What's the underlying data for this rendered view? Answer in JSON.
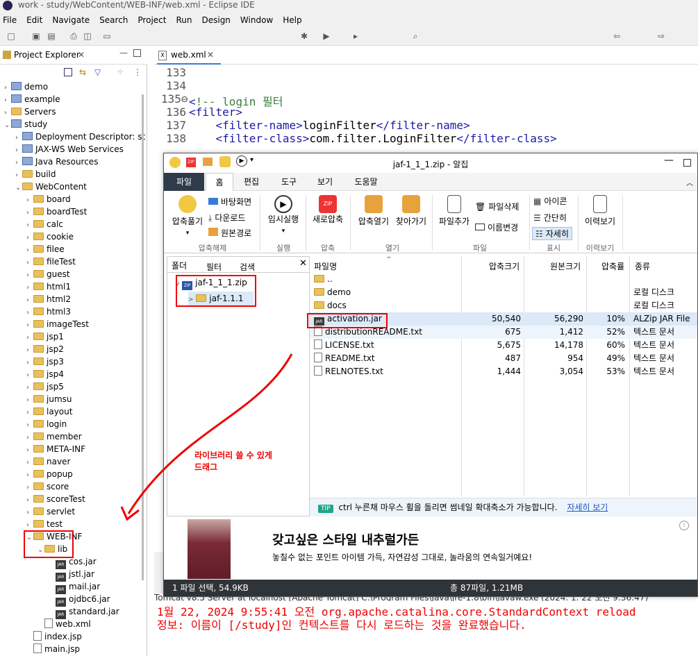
{
  "window_title": "work - study/WebContent/WEB-INF/web.xml - Eclipse IDE",
  "menu": [
    "File",
    "Edit",
    "Navigate",
    "Search",
    "Project",
    "Run",
    "Design",
    "Window",
    "Help"
  ],
  "project_explorer": {
    "title": "Project Explorer",
    "items": [
      {
        "label": "demo",
        "type": "proj",
        "depth": 0,
        "chev": ">"
      },
      {
        "label": "example",
        "type": "proj",
        "depth": 0,
        "chev": ">"
      },
      {
        "label": "Servers",
        "type": "folder",
        "depth": 0,
        "chev": ">"
      },
      {
        "label": "study",
        "type": "proj",
        "depth": 0,
        "chev": "v"
      },
      {
        "label": "Deployment Descriptor: st",
        "type": "proj",
        "depth": 1,
        "chev": ">"
      },
      {
        "label": "JAX-WS Web Services",
        "type": "proj",
        "depth": 1,
        "chev": ">"
      },
      {
        "label": "Java Resources",
        "type": "proj",
        "depth": 1,
        "chev": ">"
      },
      {
        "label": "build",
        "type": "folder",
        "depth": 1,
        "chev": ">"
      },
      {
        "label": "WebContent",
        "type": "folder",
        "depth": 1,
        "chev": "v"
      },
      {
        "label": "board",
        "type": "folder",
        "depth": 2,
        "chev": ">"
      },
      {
        "label": "boardTest",
        "type": "folder",
        "depth": 2,
        "chev": ">"
      },
      {
        "label": "calc",
        "type": "folder",
        "depth": 2,
        "chev": ">"
      },
      {
        "label": "cookie",
        "type": "folder",
        "depth": 2,
        "chev": ">"
      },
      {
        "label": "filee",
        "type": "folder",
        "depth": 2,
        "chev": ">"
      },
      {
        "label": "fileTest",
        "type": "folder",
        "depth": 2,
        "chev": ">"
      },
      {
        "label": "guest",
        "type": "folder",
        "depth": 2,
        "chev": ">"
      },
      {
        "label": "html1",
        "type": "folder",
        "depth": 2,
        "chev": ">"
      },
      {
        "label": "html2",
        "type": "folder",
        "depth": 2,
        "chev": ">"
      },
      {
        "label": "html3",
        "type": "folder",
        "depth": 2,
        "chev": ">"
      },
      {
        "label": "imageTest",
        "type": "folder",
        "depth": 2,
        "chev": ">"
      },
      {
        "label": "jsp1",
        "type": "folder",
        "depth": 2,
        "chev": ">"
      },
      {
        "label": "jsp2",
        "type": "folder",
        "depth": 2,
        "chev": ">"
      },
      {
        "label": "jsp3",
        "type": "folder",
        "depth": 2,
        "chev": ">"
      },
      {
        "label": "jsp4",
        "type": "folder",
        "depth": 2,
        "chev": ">"
      },
      {
        "label": "jsp5",
        "type": "folder",
        "depth": 2,
        "chev": ">"
      },
      {
        "label": "jumsu",
        "type": "folder",
        "depth": 2,
        "chev": ">"
      },
      {
        "label": "layout",
        "type": "folder",
        "depth": 2,
        "chev": ">"
      },
      {
        "label": "login",
        "type": "folder",
        "depth": 2,
        "chev": ">"
      },
      {
        "label": "member",
        "type": "folder",
        "depth": 2,
        "chev": ">"
      },
      {
        "label": "META-INF",
        "type": "folder",
        "depth": 2,
        "chev": ">"
      },
      {
        "label": "naver",
        "type": "folder",
        "depth": 2,
        "chev": ">"
      },
      {
        "label": "popup",
        "type": "folder",
        "depth": 2,
        "chev": ">"
      },
      {
        "label": "score",
        "type": "folder",
        "depth": 2,
        "chev": ">"
      },
      {
        "label": "scoreTest",
        "type": "folder",
        "depth": 2,
        "chev": ">"
      },
      {
        "label": "servlet",
        "type": "folder",
        "depth": 2,
        "chev": ">"
      },
      {
        "label": "test",
        "type": "folder",
        "depth": 2,
        "chev": ">"
      },
      {
        "label": "WEB-INF",
        "type": "folder",
        "depth": 2,
        "chev": "v"
      },
      {
        "label": "lib",
        "type": "folder",
        "depth": 3,
        "chev": "v"
      },
      {
        "label": "cos.jar",
        "type": "jar",
        "depth": 4,
        "chev": ""
      },
      {
        "label": "jstl.jar",
        "type": "jar",
        "depth": 4,
        "chev": ""
      },
      {
        "label": "mail.jar",
        "type": "jar",
        "depth": 4,
        "chev": ""
      },
      {
        "label": "ojdbc6.jar",
        "type": "jar",
        "depth": 4,
        "chev": ""
      },
      {
        "label": "standard.jar",
        "type": "jar",
        "depth": 4,
        "chev": ""
      },
      {
        "label": "web.xml",
        "type": "file",
        "depth": 3,
        "chev": ""
      },
      {
        "label": "index.jsp",
        "type": "file",
        "depth": 2,
        "chev": ""
      },
      {
        "label": "main.jsp",
        "type": "file",
        "depth": 2,
        "chev": ""
      }
    ]
  },
  "editor": {
    "tab": "web.xml",
    "lines": [
      {
        "n": "133",
        "parts": []
      },
      {
        "n": "134",
        "parts": []
      },
      {
        "n": "135⊖",
        "parts": [
          {
            "c": "tag",
            "t": "<"
          },
          {
            "c": "cmt",
            "t": "!-- login 필터"
          }
        ]
      },
      {
        "n": "136",
        "parts": [
          {
            "c": "tag",
            "t": "<filter>"
          }
        ]
      },
      {
        "n": "137",
        "parts": [
          {
            "c": "",
            "t": "    "
          },
          {
            "c": "tag",
            "t": "<filter-name>"
          },
          {
            "c": "",
            "t": "loginFilter"
          },
          {
            "c": "tag",
            "t": "</filter-name>"
          }
        ]
      },
      {
        "n": "138",
        "parts": [
          {
            "c": "",
            "t": "    "
          },
          {
            "c": "tag",
            "t": "<filter-class>"
          },
          {
            "c": "",
            "t": "com.filter.LoginFilter"
          },
          {
            "c": "tag",
            "t": "</filter-class>"
          }
        ]
      }
    ]
  },
  "console": {
    "header": "Tomcat v8.5 Server at localhost [Apache Tomcat] C:\\Program Files\\Java\\jre-1.8\\bin\\javaw.exe  (2024. 1. 22 오전 9:36:47)",
    "lines": [
      "1월 22, 2024 9:55:41 오전 org.apache.catalina.core.StandardContext reload",
      "정보: 이름이 [/study]인 컨텍스트를 다시 로드하는 것을 완료했습니다."
    ]
  },
  "alzip": {
    "title": "jaf-1_1_1.zip - 알집",
    "tabs": [
      "파일",
      "홈",
      "편집",
      "도구",
      "보기",
      "도움말"
    ],
    "ribbon": {
      "extract_btn": "압축풀기",
      "desktop": "바탕화면",
      "downloads": "다운로드",
      "original_path": "원본경로",
      "group_extract": "압축해제",
      "temp_run": "임시실행",
      "group_run": "실행",
      "new_zip": "새로압축",
      "group_zip": "압축",
      "open_zip": "압축열기",
      "find": "찾아가기",
      "group_open": "열기",
      "add_file": "파일추가",
      "delete_file": "파일삭제",
      "rename": "이름변경",
      "group_file": "파일",
      "icon_view": "아이콘",
      "simple_view": "간단히",
      "detail_view": "자세히",
      "group_view": "표시",
      "history": "이력보기",
      "group_history": "이력보기"
    },
    "left_tabs": [
      "폴더",
      "필터",
      "검색"
    ],
    "tree": {
      "root": "jaf-1_1_1.zip",
      "child": "jaf-1.1.1"
    },
    "columns": [
      "파일명",
      "압축크기",
      "원본크기",
      "압축률",
      "종류"
    ],
    "rows": [
      {
        "name": "..",
        "icon": "folder",
        "packed": "",
        "size": "",
        "ratio": "",
        "type": ""
      },
      {
        "name": "demo",
        "icon": "folder",
        "packed": "",
        "size": "",
        "ratio": "",
        "type": "로컬 디스크"
      },
      {
        "name": "docs",
        "icon": "folder",
        "packed": "",
        "size": "",
        "ratio": "",
        "type": "로컬 디스크"
      },
      {
        "name": "activation.jar",
        "icon": "jar",
        "packed": "50,540",
        "size": "56,290",
        "ratio": "10%",
        "type": "ALZip JAR File"
      },
      {
        "name": "distributionREADME.txt",
        "icon": "file",
        "packed": "675",
        "size": "1,412",
        "ratio": "52%",
        "type": "텍스트 문서"
      },
      {
        "name": "LICENSE.txt",
        "icon": "file",
        "packed": "5,675",
        "size": "14,178",
        "ratio": "60%",
        "type": "텍스트 문서"
      },
      {
        "name": "README.txt",
        "icon": "file",
        "packed": "487",
        "size": "954",
        "ratio": "49%",
        "type": "텍스트 문서"
      },
      {
        "name": "RELNOTES.txt",
        "icon": "file",
        "packed": "1,444",
        "size": "3,054",
        "ratio": "53%",
        "type": "텍스트 문서"
      }
    ],
    "tip_badge": "TIP",
    "tip_text": "ctrl 누른채 마우스 휠을 돌리면 썸네일 확대축소가 가능합니다.",
    "tip_link": "자세히 보기",
    "ad_title": "갖고싶은 스타일 내추럴가든",
    "ad_text": "놓칠수 없는 포인트 아이템 가득, 자연감성 그대로, 놀라움의 연속일거예요!",
    "status_left": "1 파일 선택,  54.9KB",
    "status_right": "총 87파일,  1.21MB"
  },
  "annotation": {
    "text": "라이브러리 쓸 수 있게\n드래그",
    "color": "#e00000"
  }
}
